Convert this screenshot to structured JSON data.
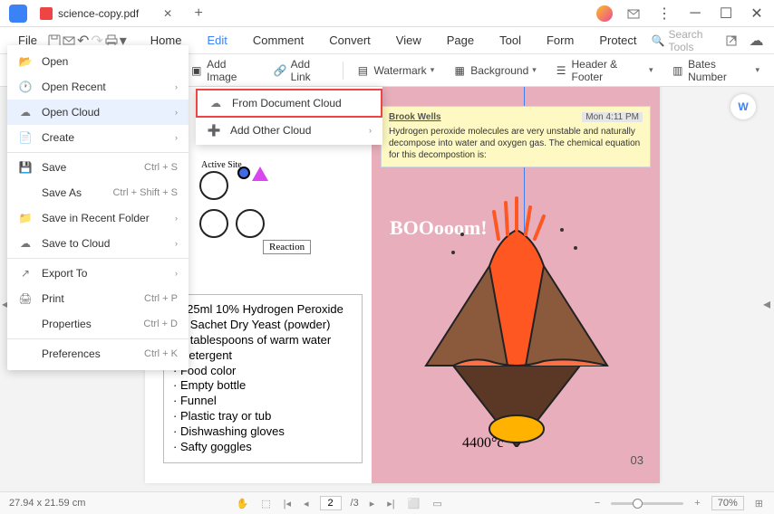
{
  "titlebar": {
    "tab_name": "science-copy.pdf"
  },
  "menubar": {
    "file": "File",
    "tabs": [
      "Home",
      "Edit",
      "Comment",
      "Convert",
      "View",
      "Page",
      "Tool",
      "Form",
      "Protect"
    ],
    "active_tab_index": 1,
    "search_placeholder": "Search Tools"
  },
  "ribbon": {
    "add_image": "Add Image",
    "add_link": "Add Link",
    "watermark": "Watermark",
    "background": "Background",
    "header_footer": "Header & Footer",
    "bates_number": "Bates Number"
  },
  "file_menu": {
    "open": "Open",
    "open_recent": "Open Recent",
    "open_cloud": "Open Cloud",
    "create": "Create",
    "save": "Save",
    "save_shortcut": "Ctrl + S",
    "save_as": "Save As",
    "save_as_shortcut": "Ctrl + Shift + S",
    "save_recent": "Save in Recent Folder",
    "save_cloud": "Save to Cloud",
    "export": "Export To",
    "print": "Print",
    "print_shortcut": "Ctrl + P",
    "properties": "Properties",
    "properties_shortcut": "Ctrl + D",
    "preferences": "Preferences",
    "preferences_shortcut": "Ctrl + K"
  },
  "submenu": {
    "from_cloud": "From Document Cloud",
    "add_other": "Add Other Cloud"
  },
  "document": {
    "active_site": "Active Site",
    "reaction": "Reaction",
    "materials": [
      "125ml 10% Hydrogen Peroxide",
      "1 Sachet Dry Yeast (powder)",
      "4 tablespoons of warm water",
      "Detergent",
      "Food color",
      "Empty bottle",
      "Funnel",
      "Plastic tray or tub",
      "Dishwashing gloves",
      "Safty goggles"
    ],
    "comment_author": "Brook Wells",
    "comment_time": "Mon 4:11 PM",
    "comment_body": "Hydrogen peroxide molecules are very unstable and naturally decompose into water and oxygen gas. The chemical equation for this decompostion is:",
    "boom": "BOOooom!",
    "temp": "4400°c",
    "page_num": "03"
  },
  "statusbar": {
    "dimensions": "27.94 x 21.59 cm",
    "page": "2",
    "total_pages": "/3",
    "zoom": "70%"
  }
}
